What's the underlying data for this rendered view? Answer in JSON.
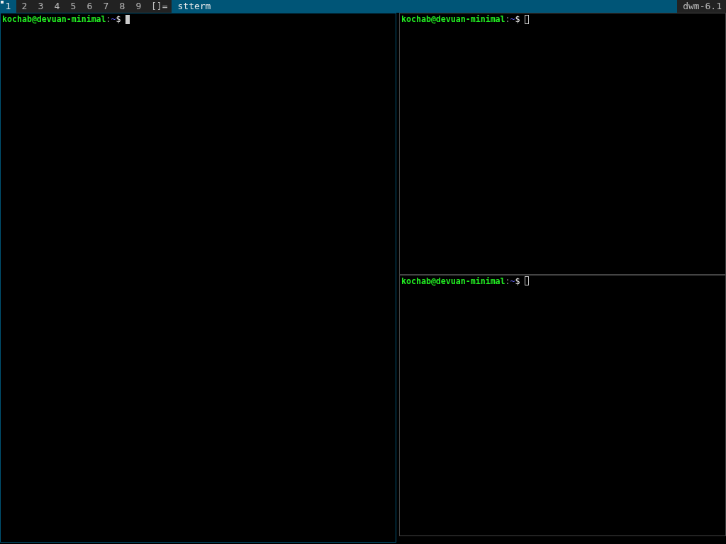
{
  "bar": {
    "tags": [
      {
        "label": "1",
        "selected": true,
        "occupied": true
      },
      {
        "label": "2",
        "selected": false,
        "occupied": false
      },
      {
        "label": "3",
        "selected": false,
        "occupied": false
      },
      {
        "label": "4",
        "selected": false,
        "occupied": false
      },
      {
        "label": "5",
        "selected": false,
        "occupied": false
      },
      {
        "label": "6",
        "selected": false,
        "occupied": false
      },
      {
        "label": "7",
        "selected": false,
        "occupied": false
      },
      {
        "label": "8",
        "selected": false,
        "occupied": false
      },
      {
        "label": "9",
        "selected": false,
        "occupied": false
      }
    ],
    "layout_symbol": "[]=",
    "window_title": "stterm",
    "status": "dwm-6.1"
  },
  "windows": [
    {
      "selected": true,
      "prompt": {
        "user_host": "kochab@devuan-minimal",
        "separator": ":",
        "path": "~",
        "symbol": "$"
      }
    },
    {
      "selected": false,
      "prompt": {
        "user_host": "kochab@devuan-minimal",
        "separator": ":",
        "path": "~",
        "symbol": "$"
      }
    },
    {
      "selected": false,
      "prompt": {
        "user_host": "kochab@devuan-minimal",
        "separator": ":",
        "path": "~",
        "symbol": "$"
      }
    }
  ]
}
